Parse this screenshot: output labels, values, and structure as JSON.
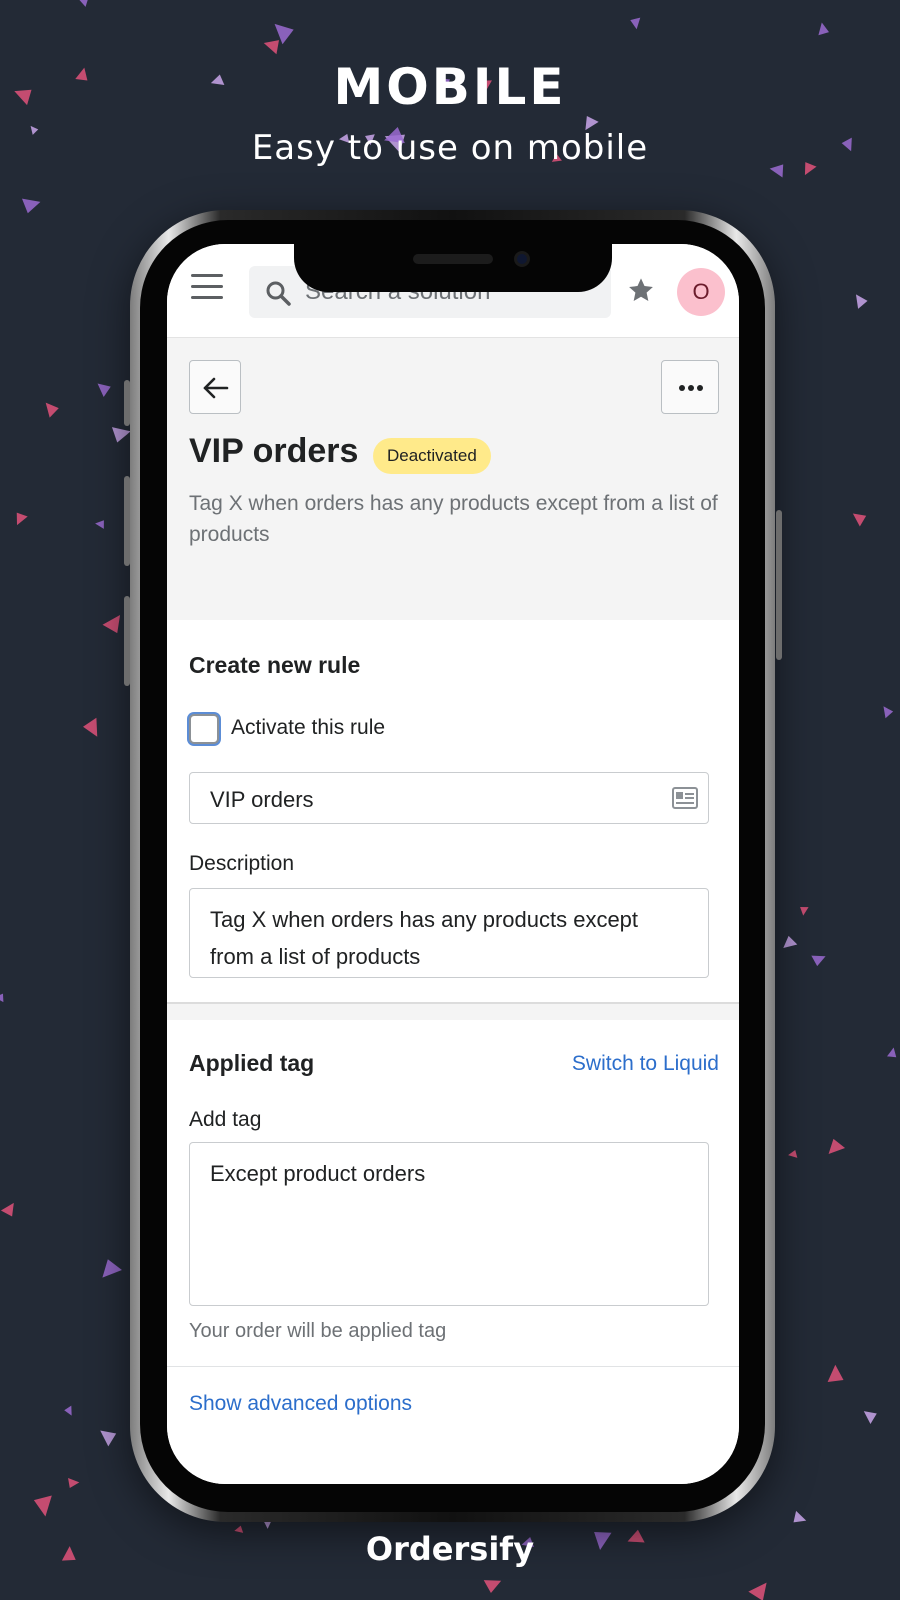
{
  "promo": {
    "title": "MOBILE",
    "subtitle": "Easy to use on mobile",
    "brand": "Ordersify",
    "background_color": "#232a36",
    "confetti_colors": [
      "#9b6bd1",
      "#e0527a",
      "#c9a6ea"
    ]
  },
  "topbar": {
    "menu_icon": "hamburger-menu-icon",
    "search_icon": "search-icon",
    "search_placeholder": "Search a solution",
    "star_icon": "star-icon",
    "avatar_initial": "O"
  },
  "header": {
    "back_icon": "arrow-left-icon",
    "more_icon": "more-horizontal-icon",
    "title": "VIP orders",
    "status_badge": "Deactivated",
    "description": "Tag X when orders has any products except from a list of products"
  },
  "rule_card": {
    "heading": "Create new rule",
    "activate_checkbox_label": "Activate this rule",
    "activate_checked": false,
    "name_value": "VIP orders",
    "name_field_icon": "contact-card-icon",
    "description_label": "Description",
    "description_value": "Tag X when orders has any products except from a list of products"
  },
  "tag_card": {
    "heading": "Applied tag",
    "switch_link": "Switch to Liquid",
    "add_tag_label": "Add tag",
    "add_tag_value": "Except product orders",
    "help_text": "Your order will be applied tag",
    "advanced_link": "Show advanced options"
  }
}
